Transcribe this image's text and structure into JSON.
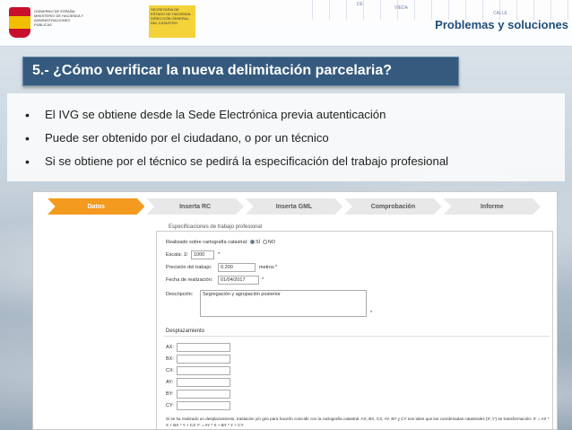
{
  "header": {
    "section_title": "Problemas y soluciones",
    "gov_logo_text": "GOBIERNO DE ESPAÑA · MINISTERIO DE HACIENDA Y ADMINISTRACIONES PÚBLICAS",
    "ign_logo_text": "SECRETARÍA DE ESTADO DE HACIENDA · DIRECCIÓN GENERAL DEL CATASTRO",
    "map_words": [
      "DE",
      "VIEDA",
      "CALLE"
    ]
  },
  "slide": {
    "title": "5.- ¿Cómo verificar la nueva delimitación parcelaria?",
    "bullets": [
      "El IVG se obtiene desde la Sede Electrónica previa autenticación",
      "Puede ser obtenido por el ciudadano, o por un técnico",
      "Si se obtiene por el técnico se pedirá la especificación del trabajo profesional"
    ]
  },
  "form": {
    "steps": [
      "Datos",
      "Inserta RC",
      "Inserta GML",
      "Comprobación",
      "Informe"
    ],
    "active_step": "Datos",
    "legend": "Especificaciones de trabajo profesional",
    "realizado_label": "Realizado sobre cartografía catastral:",
    "si": "SÍ",
    "no": "NO",
    "escala_label": "Escala: 1/",
    "escala_value": "1000",
    "precision_label": "Precisión del trabajo:",
    "precision_value": "0.200",
    "precision_unit": "metros",
    "fecha_label": "Fecha de realización:",
    "fecha_value": "01/04/2017",
    "descripcion_label": "Descripción:",
    "descripcion_value": "Segregación y agrupación posterior",
    "required_mark": "*",
    "desplazamiento_label": "Desplazamiento",
    "coord_labels": [
      "AX:",
      "BX:",
      "CX:",
      "AY:",
      "BY:",
      "CY:"
    ],
    "footnote": "Si se ha realizado un desplazamiento, traslación y/o giro para hacerlo coincidir con la cartografía catastral. AX, BX, CX, AY, BY y CY son tales que las coordenadas catastrales (X',Y') se transformación: X' = AX * X + BX * Y + CX    Y' = AY * X + BY * Y + CY"
  },
  "colors": {
    "title_bar": "#355a7e",
    "section_title": "#1f4e79",
    "active_step": "#f39a1f"
  }
}
